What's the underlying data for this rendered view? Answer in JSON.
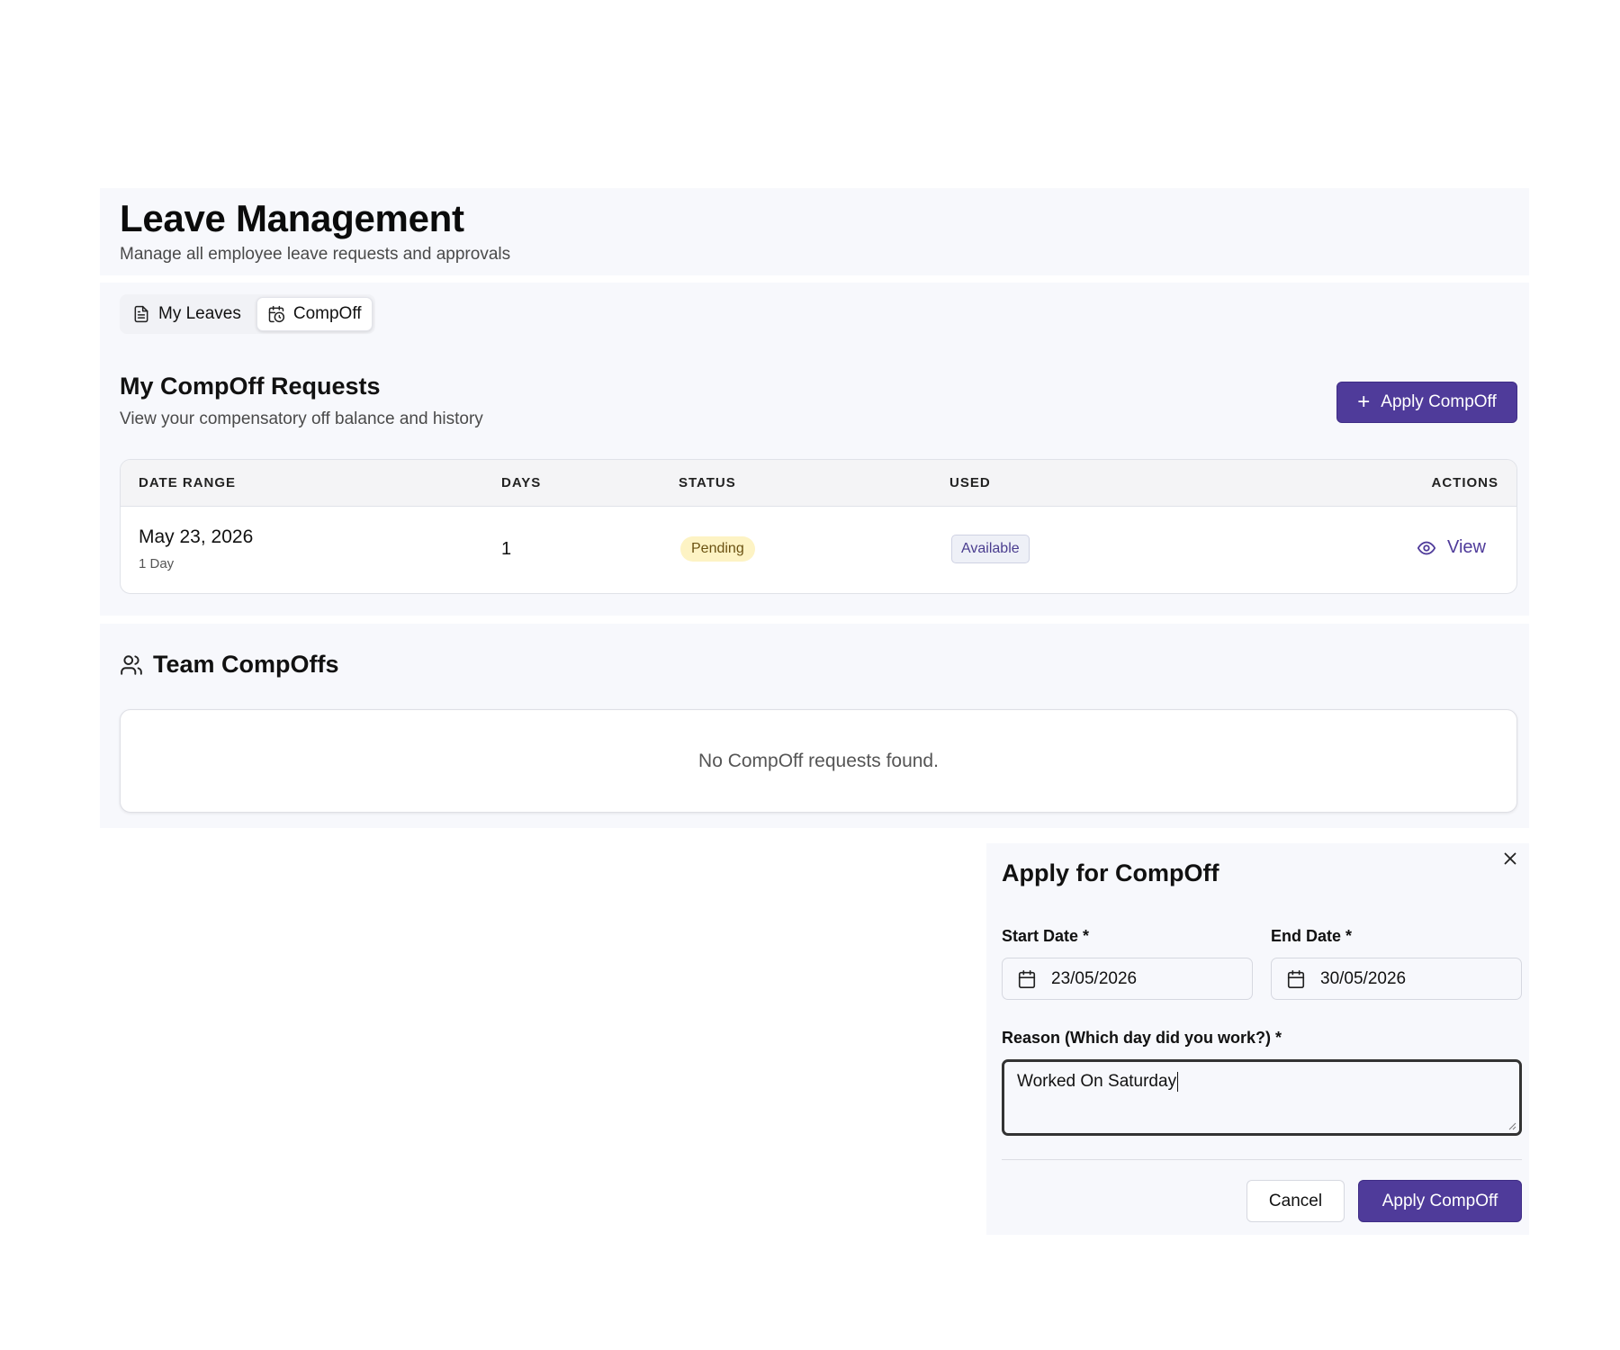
{
  "header": {
    "title": "Leave Management",
    "subtitle": "Manage all employee leave requests and approvals"
  },
  "tabs": [
    {
      "label": "My Leaves",
      "icon": "document-icon",
      "active": false
    },
    {
      "label": "CompOff",
      "icon": "calendar-clock-icon",
      "active": true
    }
  ],
  "compoff_section": {
    "title": "My CompOff Requests",
    "subtitle": "View your compensatory off balance and history",
    "apply_button": "Apply CompOff"
  },
  "table": {
    "columns": [
      "DATE RANGE",
      "DAYS",
      "STATUS",
      "USED",
      "ACTIONS"
    ],
    "rows": [
      {
        "date": "May 23, 2026",
        "duration": "1 Day",
        "days": "1",
        "status": "Pending",
        "used": "Available",
        "action": "View"
      }
    ]
  },
  "team_section": {
    "title": "Team CompOffs",
    "icon": "users-icon",
    "empty_message": "No CompOff requests found."
  },
  "dialog": {
    "title": "Apply for CompOff",
    "start_label": "Start Date *",
    "start_value": "23/05/2026",
    "end_label": "End Date *",
    "end_value": "30/05/2026",
    "reason_label": "Reason (Which day did you work?) *",
    "reason_value": "Worked On Saturday",
    "cancel_button": "Cancel",
    "submit_button": "Apply CompOff"
  },
  "colors": {
    "accent": "#4f3b9a",
    "panel": "#f7f8fc",
    "pending_bg": "#fdf3c4",
    "available_bg": "#eef0f7"
  }
}
